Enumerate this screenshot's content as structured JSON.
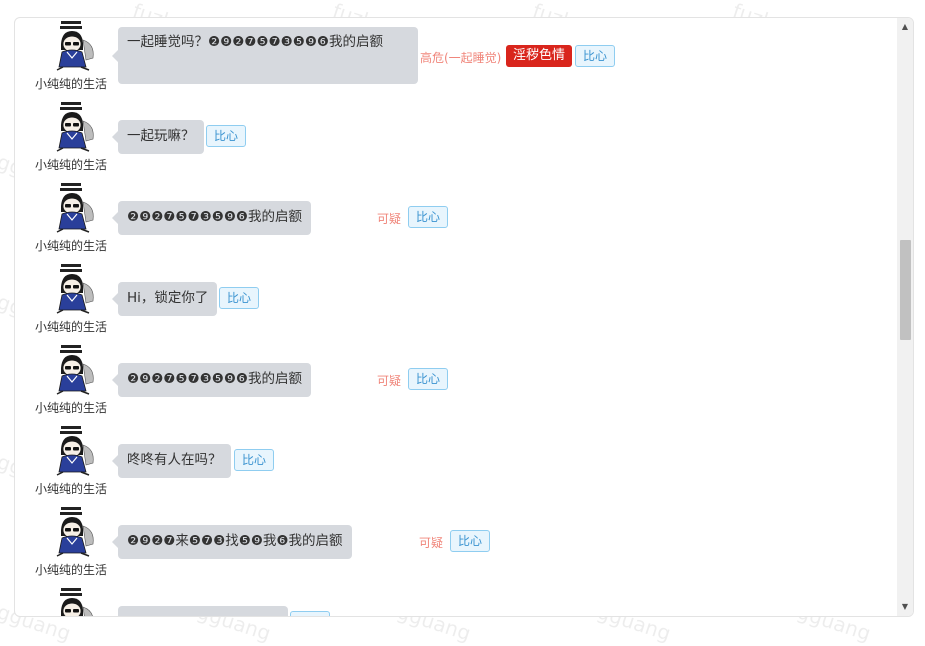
{
  "watermark": "fuzhengguang",
  "colors": {
    "bubble": "#d6d9de",
    "risk_text": "#f0857a",
    "porn_tag": "#d9251c",
    "bixin_border": "#8fcdf0",
    "bixin_text": "#3a93d0"
  },
  "messages": [
    {
      "username": "小纯纯的生活",
      "text": "一起睡觉吗？❷❾❷❼❺❼❸❺❾❻我的启额",
      "risk_label": "高危(一起睡觉)",
      "category_tag": "淫秽色情",
      "action_label": "比心"
    },
    {
      "username": "小纯纯的生活",
      "text": "一起玩嘛？",
      "action_label": "比心"
    },
    {
      "username": "小纯纯的生活",
      "text": "❷❾❷❼❺❼❸❺❾❻我的启额",
      "risk_label": "可疑",
      "action_label": "比心"
    },
    {
      "username": "小纯纯的生活",
      "text": "Hi，锁定你了",
      "action_label": "比心"
    },
    {
      "username": "小纯纯的生活",
      "text": "❷❾❷❼❺❼❸❺❾❻我的启额",
      "risk_label": "可疑",
      "action_label": "比心"
    },
    {
      "username": "小纯纯的生活",
      "text": "咚咚有人在吗？",
      "action_label": "比心"
    },
    {
      "username": "小纯纯的生活",
      "text": "❷❾❷❼来❺❼❸找❺❾我❻我的启额",
      "risk_label": "可疑",
      "action_label": "比心"
    },
    {
      "username": "",
      "text": "",
      "action_label": ""
    }
  ],
  "icons": {
    "avatar": "cartoon-girl-avatar-icon",
    "scroll_up": "scroll-up-arrow-icon",
    "scroll_down": "scroll-down-arrow-icon"
  }
}
